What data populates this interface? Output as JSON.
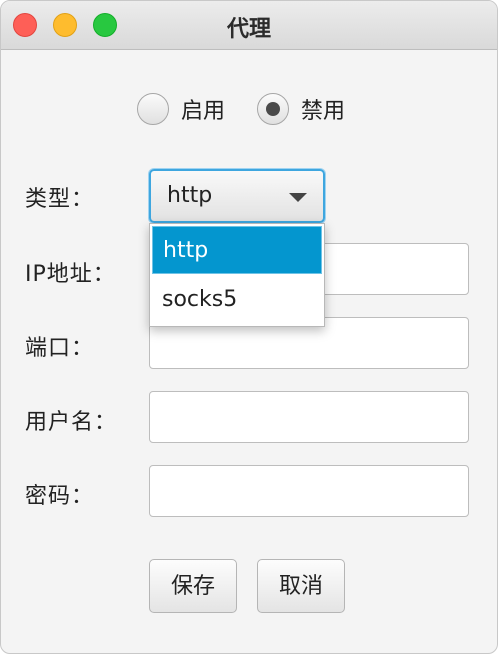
{
  "window": {
    "title": "代理"
  },
  "mode": {
    "options": [
      {
        "label": "启用",
        "selected": false
      },
      {
        "label": "禁用",
        "selected": true
      }
    ]
  },
  "form": {
    "type_label": "类型：",
    "type_value": "http",
    "type_options": [
      "http",
      "socks5"
    ],
    "ip_label": "IP地址：",
    "ip_value": "",
    "port_label": "端口：",
    "port_value": "",
    "username_label": "用户名：",
    "username_value": "",
    "password_label": "密码："
  },
  "buttons": {
    "save": "保存",
    "cancel": "取消"
  },
  "colors": {
    "selection": "#0496cf",
    "focus_ring": "#3ea6df",
    "close": "#fe5f57",
    "minimize": "#febc2e",
    "maximize": "#28c840"
  }
}
